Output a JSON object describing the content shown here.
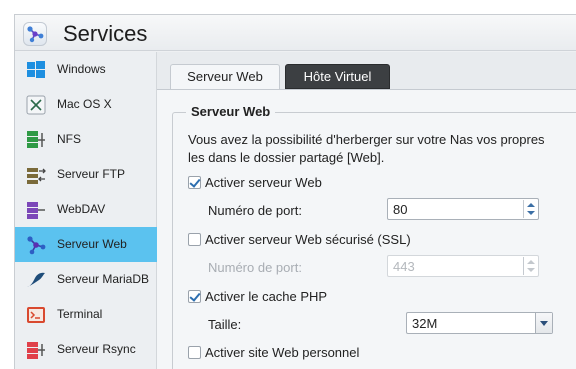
{
  "window": {
    "title": "Services"
  },
  "sidebar": {
    "items": [
      {
        "label": "Windows",
        "icon": "windows-icon",
        "active": false
      },
      {
        "label": "Mac OS X",
        "icon": "macos-icon",
        "active": false
      },
      {
        "label": "NFS",
        "icon": "nfs-icon",
        "active": false
      },
      {
        "label": "Serveur FTP",
        "icon": "ftp-icon",
        "active": false
      },
      {
        "label": "WebDAV",
        "icon": "webdav-icon",
        "active": false
      },
      {
        "label": "Serveur Web",
        "icon": "web-server-icon",
        "active": true
      },
      {
        "label": "Serveur MariaDB",
        "icon": "mariadb-icon",
        "active": false
      },
      {
        "label": "Terminal",
        "icon": "terminal-icon",
        "active": false
      },
      {
        "label": "Serveur Rsync",
        "icon": "rsync-icon",
        "active": false
      }
    ]
  },
  "tabs": {
    "web": "Serveur Web",
    "vhost": "Hôte Virtuel"
  },
  "section": {
    "legend": "Serveur Web",
    "desc_line1": "Vous avez la possibilité d'herberger sur votre Nas vos propres",
    "desc_line2": "les dans le dossier partagé [Web]."
  },
  "web": {
    "enable_label": "Activer serveur Web",
    "enable_checked": true,
    "port_label": "Numéro de port:",
    "port_value": "80"
  },
  "ssl": {
    "enable_label": "Activer serveur Web sécurisé (SSL)",
    "enable_checked": false,
    "port_label": "Numéro de port:",
    "port_value": "443"
  },
  "cache": {
    "enable_label": "Activer le cache PHP",
    "enable_checked": true,
    "size_label": "Taille:",
    "size_value": "32M"
  },
  "personal": {
    "enable_label": "Activer site Web personnel",
    "enable_checked": false
  },
  "colors": {
    "accent": "#5bc2ef",
    "tab_inactive": "#3c3f42"
  }
}
